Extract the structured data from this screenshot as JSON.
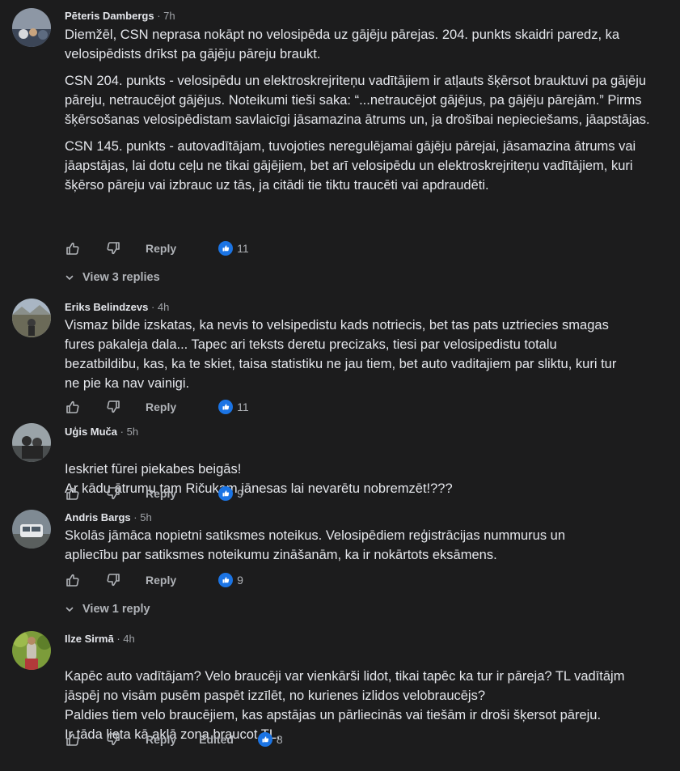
{
  "comments": [
    {
      "author": "Pēteris Dambergs",
      "time": "7h",
      "paragraphs": [
        "Diemžēl, CSN neprasa nokāpt no velosipēda uz gājēju pārejas. 204. punkts skaidri paredz, ka velosipēdists drīkst pa gājēju pāreju braukt.",
        "CSN 204. punkts - velosipēdu un elektroskrejriteņu vadītājiem ir atļauts šķērsot brauktuvi pa gājēju pāreju, netraucējot gājējus. Noteikumi tieši saka: “...netraucējot gājējus, pa gājēju pārejām.” Pirms šķērsošanas velosipēdistam savlaicīgi jāsamazina ātrums un, ja drošībai nepieciešams, jāapstājas.",
        "CSN 145. punkts - autovadītājam, tuvojoties neregulējamai gājēju pārejai, jāsamazina ātrums vai jāapstājas, lai dotu ceļu ne tikai gājējiem, bet arī velosipēdu un elektroskrejriteņu vadītājiem, kuri šķērso pāreju vai izbrauc uz tās, ja citādi tie tiktu traucēti vai apdraudēti."
      ],
      "reply_label": "Reply",
      "reactions": "11",
      "view_replies": "View 3 replies"
    },
    {
      "author": "Eriks Belindzevs",
      "time": "4h",
      "paragraphs": [
        "Vismaz bilde izskatas, ka nevis to velsipedistu kads notriecis, bet tas pats uztriecies smagas fures pakaleja dala... Tapec ari teksts deretu precizaks, tiesi par velosipedistu totalu bezatbildibu, kas, ka te skiet, taisa statistiku ne jau tiem, bet auto vaditajiem par sliktu, kuri tur ne pie ka nav vainigi."
      ],
      "reply_label": "Reply",
      "reactions": "11"
    },
    {
      "author": "Uģis Muča",
      "time": "5h",
      "paragraphs": [
        "Ieskriet fūrei piekabes beigās!\nAr kādu ātrumu tam Ričukam jānesas lai nevarētu nobremzēt!???"
      ],
      "reply_label": "Reply",
      "reactions": "9"
    },
    {
      "author": "Andris Bargs",
      "time": "5h",
      "paragraphs": [
        "Skolās jāmāca nopietni satiksmes noteikus. Velosipēdiem reģistrācijas nummurus un apliecību par satiksmes noteikumu zināšanām, ka ir nokārtots eksāmens."
      ],
      "reply_label": "Reply",
      "reactions": "9",
      "view_replies": "View 1 reply"
    },
    {
      "author": "Ilze Sirmā",
      "time": "4h",
      "paragraphs": [
        "Kapēc auto vadītājam? Velo braucēji var vienkārši lidot, tikai tapēc ka tur ir pāreja? TL vadītājm jāspēj no visām pusēm paspēt izzīlēt, no kurienes izlidos velobraucējs?\nPaldies tiem velo braucējiem, kas apstājas un pārliecinās vai tiešām ir droši šķersot pāreju.\nIr tāda lieta kā aklā zona braucot TL."
      ],
      "reply_label": "Reply",
      "edited_label": "Edited",
      "reactions": "8"
    }
  ],
  "colors": {
    "background": "#1c1c1d",
    "like_blue": "#1b74e4",
    "muted": "#b0b3b8"
  },
  "icons": {
    "like": "thumbs-up-icon",
    "dislike": "thumbs-down-icon",
    "reaction": "blue-like-reaction-icon",
    "expand": "chevron-down-icon"
  }
}
